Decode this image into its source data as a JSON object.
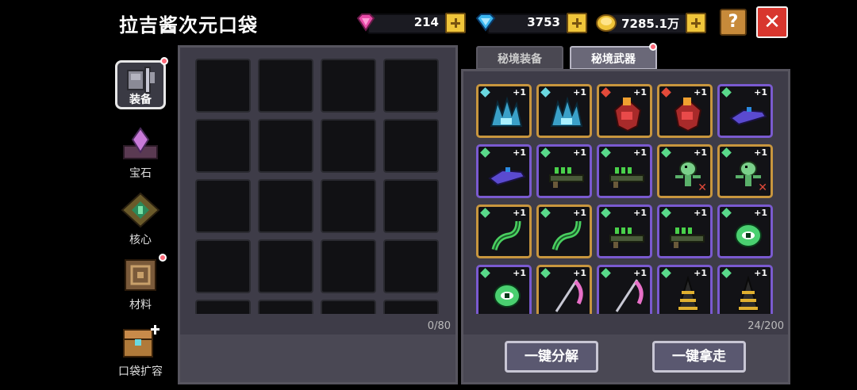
{
  "title": "拉吉酱次元口袋",
  "currency": {
    "gems": "214",
    "diamonds": "3753",
    "gold": "7285.1万"
  },
  "help_label": "?",
  "close_label": "✕",
  "sidebar": [
    {
      "label": "装备",
      "icon": "armor-icon",
      "active": true,
      "badge": true
    },
    {
      "label": "宝石",
      "icon": "gem-icon",
      "active": false,
      "badge": false
    },
    {
      "label": "核心",
      "icon": "core-icon",
      "active": false,
      "badge": false
    },
    {
      "label": "材料",
      "icon": "material-icon",
      "active": false,
      "badge": true
    },
    {
      "label": "口袋扩容",
      "icon": "chest-icon",
      "active": false,
      "badge": false
    }
  ],
  "pocket": {
    "count": "0/80"
  },
  "tabs": [
    {
      "label": "秘境装备",
      "active": false
    },
    {
      "label": "秘境武器",
      "active": true
    }
  ],
  "weapons": {
    "count": "24/200",
    "items": [
      {
        "icon": "ice-crown-weapon-icon",
        "level": "+1",
        "rarity": "gold",
        "tag": "ice"
      },
      {
        "icon": "ice-crown-weapon-icon",
        "level": "+1",
        "rarity": "gold",
        "tag": "ice"
      },
      {
        "icon": "dragon-heart-weapon-icon",
        "level": "+1",
        "rarity": "gold",
        "tag": "fire"
      },
      {
        "icon": "dragon-heart-weapon-icon",
        "level": "+1",
        "rarity": "gold",
        "tag": "fire"
      },
      {
        "icon": "shark-blaster-icon",
        "level": "+1",
        "rarity": "purple",
        "tag": "green"
      },
      {
        "icon": "shark-blaster-icon",
        "level": "+1",
        "rarity": "purple",
        "tag": "green"
      },
      {
        "icon": "green-rifle-icon",
        "level": "+1",
        "rarity": "purple",
        "tag": "green"
      },
      {
        "icon": "green-rifle-icon",
        "level": "+1",
        "rarity": "purple",
        "tag": "green"
      },
      {
        "icon": "frog-staff-icon",
        "level": "+1",
        "rarity": "gold",
        "tag": "green",
        "broken": true
      },
      {
        "icon": "frog-staff-icon",
        "level": "+1",
        "rarity": "gold",
        "tag": "green",
        "broken": true
      },
      {
        "icon": "vine-whip-icon",
        "level": "+1",
        "rarity": "gold",
        "tag": "green"
      },
      {
        "icon": "vine-whip-icon",
        "level": "+1",
        "rarity": "gold",
        "tag": "green"
      },
      {
        "icon": "green-rifle-icon",
        "level": "+1",
        "rarity": "purple",
        "tag": "green"
      },
      {
        "icon": "green-rifle-icon",
        "level": "+1",
        "rarity": "purple",
        "tag": "green"
      },
      {
        "icon": "slime-eye-icon",
        "level": "+1",
        "rarity": "purple",
        "tag": "green"
      },
      {
        "icon": "slime-eye-icon",
        "level": "+1",
        "rarity": "purple",
        "tag": "green"
      },
      {
        "icon": "pink-scythe-icon",
        "level": "+1",
        "rarity": "gold",
        "tag": "green"
      },
      {
        "icon": "pink-scythe-icon",
        "level": "+1",
        "rarity": "purple",
        "tag": "green"
      },
      {
        "icon": "drill-spire-icon",
        "level": "+1",
        "rarity": "purple",
        "tag": "green"
      },
      {
        "icon": "drill-spire-icon",
        "level": "+1",
        "rarity": "purple",
        "tag": "green"
      }
    ]
  },
  "actions": {
    "decompose": "一键分解",
    "take_all": "一键拿走"
  },
  "colors": {
    "rarity_gold": "#c8963e",
    "rarity_purple": "#7a5ad0",
    "tag_green": "#59d98a",
    "tag_ice": "#6ad8e0",
    "tag_fire": "#e24a3a"
  }
}
